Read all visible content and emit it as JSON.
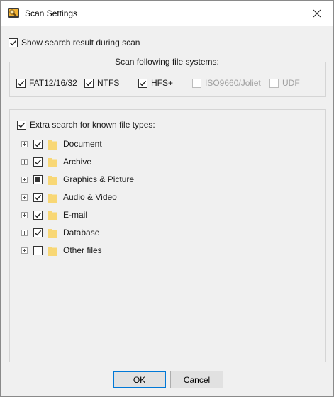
{
  "window": {
    "title": "Scan Settings"
  },
  "show_search": {
    "label": "Show search result during scan",
    "checked": true
  },
  "file_systems": {
    "title": "Scan following file systems:",
    "items": [
      {
        "label": "FAT12/16/32",
        "checked": true,
        "enabled": true
      },
      {
        "label": "NTFS",
        "checked": true,
        "enabled": true
      },
      {
        "label": "HFS+",
        "checked": true,
        "enabled": true
      },
      {
        "label": "ISO9660/Joliet",
        "checked": false,
        "enabled": false
      },
      {
        "label": "UDF",
        "checked": false,
        "enabled": false
      }
    ]
  },
  "extra_search": {
    "label": "Extra search for known file types:",
    "checked": true,
    "items": [
      {
        "label": "Document",
        "state": "checked"
      },
      {
        "label": "Archive",
        "state": "checked"
      },
      {
        "label": "Graphics & Picture",
        "state": "partial"
      },
      {
        "label": "Audio & Video",
        "state": "checked"
      },
      {
        "label": "E-mail",
        "state": "checked"
      },
      {
        "label": "Database",
        "state": "checked"
      },
      {
        "label": "Other files",
        "state": "unchecked"
      }
    ]
  },
  "buttons": {
    "ok": "OK",
    "cancel": "Cancel"
  },
  "colors": {
    "folder": "#f8d775",
    "accent": "#0078d7"
  }
}
